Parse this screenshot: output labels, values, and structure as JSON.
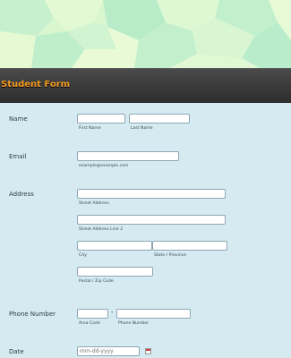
{
  "form": {
    "title": "Student Form",
    "name": {
      "label": "Name",
      "first_sublabel": "First Name",
      "last_sublabel": "Last Name"
    },
    "email": {
      "label": "Email",
      "sublabel": "example@example.com"
    },
    "address": {
      "label": "Address",
      "street_sublabel": "Street Address",
      "street2_sublabel": "Street Address Line 2",
      "city_sublabel": "City",
      "state_sublabel": "State / Province",
      "postal_sublabel": "Postal / Zip Code"
    },
    "phone": {
      "label": "Phone Number",
      "separator": "-",
      "area_sublabel": "Area Code",
      "number_sublabel": "Phone Number"
    },
    "date": {
      "label": "Date",
      "placeholder": "mm-dd-yyyy"
    }
  },
  "colors": {
    "header_bg": "#333333",
    "title_color": "#f49b1e",
    "form_bg": "#d5ebf1",
    "hero_bg": "#d9f7d2"
  }
}
